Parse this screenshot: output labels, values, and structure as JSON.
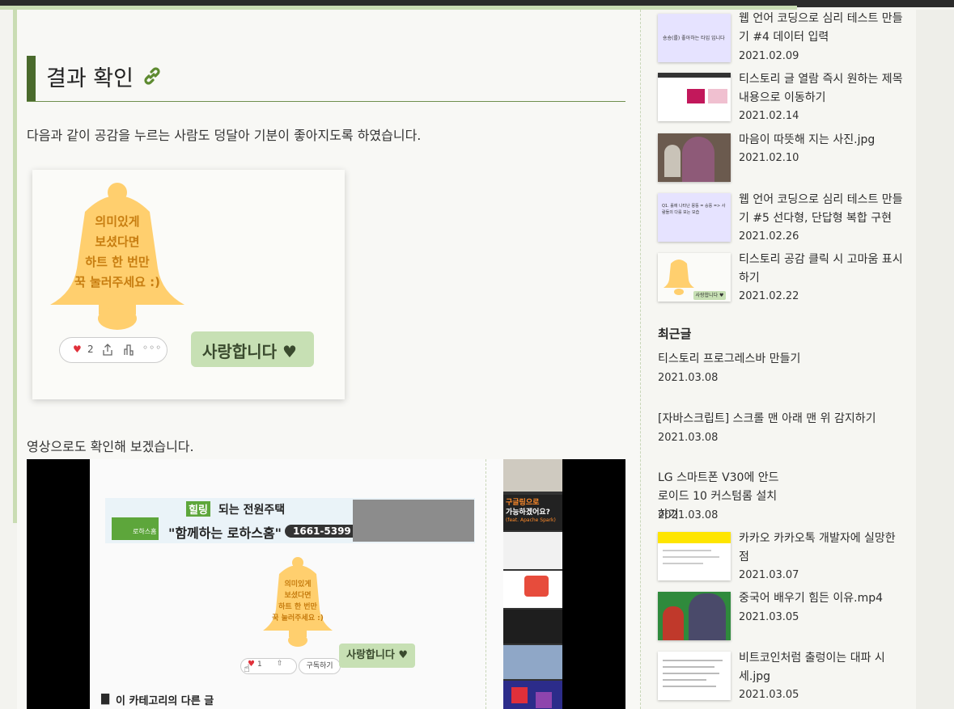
{
  "heading": {
    "title": "결과 확인"
  },
  "post": {
    "paragraph1": "다음과 같이 공감을 누르는 사람도 덩달아 기분이 좋아지도록 하였습니다.",
    "paragraph2": "영상으로도 확인해 보겠습니다."
  },
  "bell_card": {
    "line1": "의미있게",
    "line2": "보셨다면",
    "line3": "하트 한 번만",
    "line4": "꾹 눌러주세요 :)",
    "like_count": "2",
    "love_button": "사랑합니다 ♥"
  },
  "video": {
    "banner_badge": "힐링",
    "banner_title": "되는 전원주택",
    "banner_sub": "\"함께하는 로하스홈\"",
    "banner_phone": "1661-5399",
    "banner_logo": "로하스홈",
    "bell_line1": "의미있게",
    "bell_line2": "보셨다면",
    "bell_line3": "하트 한 번만",
    "bell_line4": "꾹 눌러주세요 :)",
    "like_count": "1",
    "subscribe": "구독하기",
    "love_button": "사랑합니다 ♥",
    "category_title": "이 카테고리의 다른 글",
    "side_thumb_text1": "구글링으로",
    "side_thumb_text2": "가능하겠어요?",
    "side_thumb_text3": "(feat. Apache Spark)"
  },
  "sidebar": {
    "category_posts": [
      {
        "title": "웹 언어 코딩으로 심리 테스트 만들기 #4 데이터 입력",
        "date": "2021.02.09",
        "thumb_text": "숑숑(를) 좋아하는 타입 입니다"
      },
      {
        "title": "티스토리 글 열람 즉시 원하는 제목 내용으로 이동하기",
        "date": "2021.02.14"
      },
      {
        "title": "마음이 따뜻해 지는 사진.jpg",
        "date": "2021.02.10"
      },
      {
        "title": "웹 언어 코딩으로 심리 테스트 만들기 #5 선다형, 단답형 복합 구현",
        "date": "2021.02.26",
        "thumb_text": "Q1. 롤에 나타난 몽뚱 = 숑뚱 => 사람들의 다를 보는 모습"
      },
      {
        "title": "티스토리 공감 클릭 시 고마움 표시하기",
        "date": "2021.02.22",
        "thumb_btn": "사랑합니다 ♥"
      }
    ],
    "recent_heading": "최근글",
    "recent_posts_text": [
      {
        "title": "티스토리 프로그레스바 만들기",
        "date": "2021.03.08"
      },
      {
        "title": "[자바스크립트] 스크롤 맨 아래 맨 위 감지하기",
        "date": "2021.03.08"
      },
      {
        "title": "LG 스마트폰 V30에 안드로이드 10 커스텀롬 설치하기",
        "date": "2021.03.08"
      }
    ],
    "recent_posts_thumb": [
      {
        "title": "카카오 카카오톡 개발자에 실망한 점",
        "date": "2021.03.07"
      },
      {
        "title": "중국어 배우기 힘든 이유.mp4",
        "date": "2021.03.05"
      },
      {
        "title": "비트코인처럼 출렁이는 대파 시세.jpg",
        "date": "2021.03.05"
      }
    ]
  },
  "colors": {
    "accent": "#4a6a2c",
    "bell": "#ffcf6e",
    "love_button": "#c7e0b4"
  },
  "icons": [
    "link-icon",
    "heart-icon",
    "share-icon",
    "stats-icon",
    "more-icon",
    "book-icon",
    "cursor-hand-icon"
  ]
}
